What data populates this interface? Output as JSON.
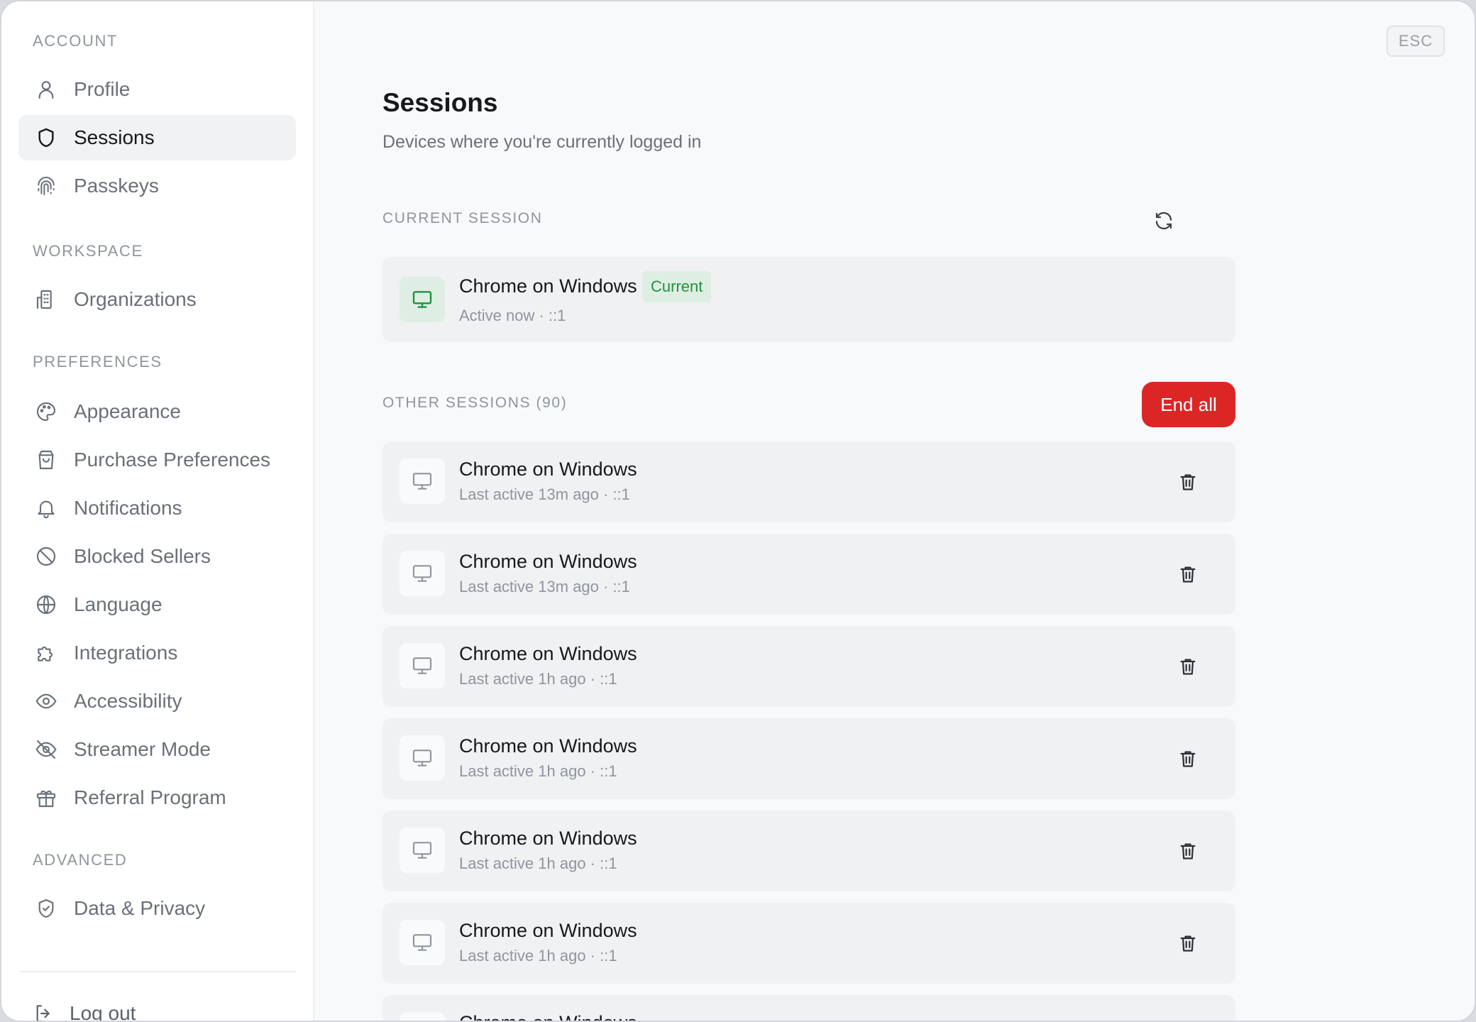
{
  "sidebar": {
    "account_label": "ACCOUNT",
    "account_items": [
      {
        "label": "Profile",
        "icon": "user-icon"
      },
      {
        "label": "Sessions",
        "icon": "shield-icon"
      },
      {
        "label": "Passkeys",
        "icon": "fingerprint-icon"
      }
    ],
    "workspace_label": "WORKSPACE",
    "workspace_items": [
      {
        "label": "Organizations",
        "icon": "building-icon"
      }
    ],
    "preferences_label": "PREFERENCES",
    "preferences_items": [
      {
        "label": "Appearance",
        "icon": "palette-icon"
      },
      {
        "label": "Purchase Preferences",
        "icon": "shopping-bag-icon"
      },
      {
        "label": "Notifications",
        "icon": "bell-icon"
      },
      {
        "label": "Blocked Sellers",
        "icon": "ban-icon"
      },
      {
        "label": "Language",
        "icon": "globe-icon"
      },
      {
        "label": "Integrations",
        "icon": "puzzle-icon"
      },
      {
        "label": "Accessibility",
        "icon": "eye-icon"
      },
      {
        "label": "Streamer Mode",
        "icon": "eye-off-icon"
      },
      {
        "label": "Referral Program",
        "icon": "gift-icon"
      }
    ],
    "advanced_label": "ADVANCED",
    "advanced_items": [
      {
        "label": "Data & Privacy",
        "icon": "shield-check-icon"
      }
    ],
    "logout_label": "Log out"
  },
  "main": {
    "esc_label": "ESC",
    "title": "Sessions",
    "subtitle": "Devices where you're currently logged in",
    "current_section_label": "CURRENT SESSION",
    "current_session": {
      "device": "Chrome on Windows",
      "badge": "Current",
      "meta": "Active now · ::1"
    },
    "other_section_label": "OTHER SESSIONS (90)",
    "end_all_label": "End all",
    "other_sessions": [
      {
        "device": "Chrome on Windows",
        "meta": "Last active 13m ago · ::1"
      },
      {
        "device": "Chrome on Windows",
        "meta": "Last active 13m ago · ::1"
      },
      {
        "device": "Chrome on Windows",
        "meta": "Last active 1h ago · ::1"
      },
      {
        "device": "Chrome on Windows",
        "meta": "Last active 1h ago · ::1"
      },
      {
        "device": "Chrome on Windows",
        "meta": "Last active 1h ago · ::1"
      },
      {
        "device": "Chrome on Windows",
        "meta": "Last active 1h ago · ::1"
      },
      {
        "device": "Chrome on Windows",
        "meta": ""
      }
    ]
  },
  "colors": {
    "accent_green": "#22913f",
    "danger_red": "#dc2626",
    "active_bg": "#f1f2f4"
  }
}
